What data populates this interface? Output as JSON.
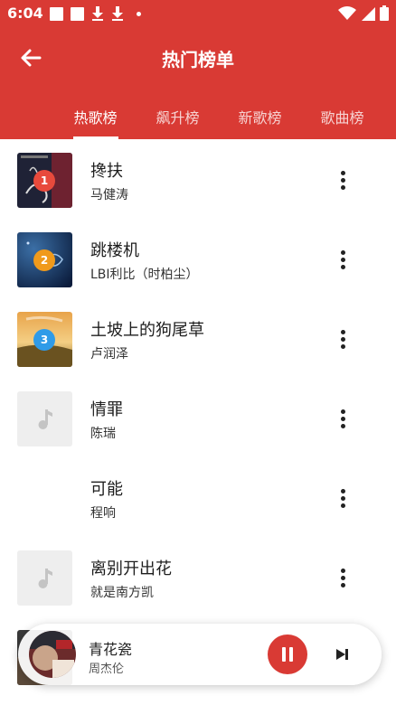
{
  "status_bar": {
    "time": "6:04"
  },
  "header": {
    "title": "热门榜单",
    "tabs": [
      {
        "label": "热歌榜",
        "active": true
      },
      {
        "label": "飙升榜",
        "active": false
      },
      {
        "label": "新歌榜",
        "active": false
      },
      {
        "label": "歌曲榜",
        "active": false
      }
    ]
  },
  "songs": [
    {
      "rank": "1",
      "title": "搀扶",
      "artist": "马健涛",
      "rank_color": "#e84a3c",
      "cover": "album-art"
    },
    {
      "rank": "2",
      "title": "跳楼机",
      "artist": "LBI利比（时柏尘）",
      "rank_color": "#f09a1b",
      "cover": "album-art"
    },
    {
      "rank": "3",
      "title": "土坡上的狗尾草",
      "artist": "卢润泽",
      "rank_color": "#2f9be8",
      "cover": "album-art"
    },
    {
      "rank": "",
      "title": "情罪",
      "artist": "陈瑞",
      "cover": "music-note-placeholder"
    },
    {
      "rank": "",
      "title": "可能",
      "artist": "程响",
      "cover": "none"
    },
    {
      "rank": "",
      "title": "离别开出花",
      "artist": "就是南方凯",
      "cover": "music-note-placeholder"
    }
  ],
  "now_playing": {
    "title": "青花瓷",
    "artist": "周杰伦",
    "state": "playing"
  },
  "colors": {
    "primary": "#d93a34",
    "placeholder_bg": "#eeeeee"
  }
}
